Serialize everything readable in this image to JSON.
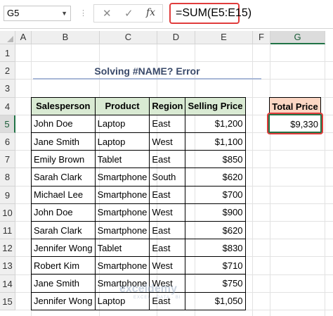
{
  "formula_bar": {
    "name_box": "G5",
    "cancel_icon": "✕",
    "enter_icon": "✓",
    "fx_icon": "fx",
    "formula": "=SUM(E5:E15)"
  },
  "grid": {
    "columns": [
      "A",
      "B",
      "C",
      "D",
      "E",
      "F",
      "G"
    ],
    "rows": [
      "1",
      "2",
      "3",
      "4",
      "5",
      "6",
      "7",
      "8",
      "9",
      "10",
      "11",
      "12",
      "13",
      "14",
      "15"
    ],
    "selected_column": "G",
    "selected_row": "5"
  },
  "sheet": {
    "title": "Solving #NAME? Error",
    "headers": [
      "Salesperson",
      "Product",
      "Region",
      "Selling Price"
    ],
    "rows": [
      [
        "John Doe",
        "Laptop",
        "East",
        "$1,200"
      ],
      [
        "Jane Smith",
        "Laptop",
        "West",
        "$1,100"
      ],
      [
        "Emily Brown",
        "Tablet",
        "East",
        "$850"
      ],
      [
        "Sarah Clark",
        "Smartphone",
        "South",
        "$620"
      ],
      [
        "Michael Lee",
        "Smartphone",
        "East",
        "$700"
      ],
      [
        "John Doe",
        "Smartphone",
        "West",
        "$900"
      ],
      [
        "Sarah Clark",
        "Smartphone",
        "East",
        "$620"
      ],
      [
        "Jennifer Wong",
        "Tablet",
        "East",
        "$830"
      ],
      [
        "Robert Kim",
        "Smartphone",
        "West",
        "$710"
      ],
      [
        "Jane Smith",
        "Smartphone",
        "West",
        "$750"
      ],
      [
        "Jennifer Wong",
        "Laptop",
        "East",
        "$1,050"
      ]
    ],
    "total_header": "Total Price",
    "total_value": "$9,330"
  },
  "watermark": {
    "brand": "exceldemy",
    "tagline": "EXCEL · DATA · BI"
  }
}
